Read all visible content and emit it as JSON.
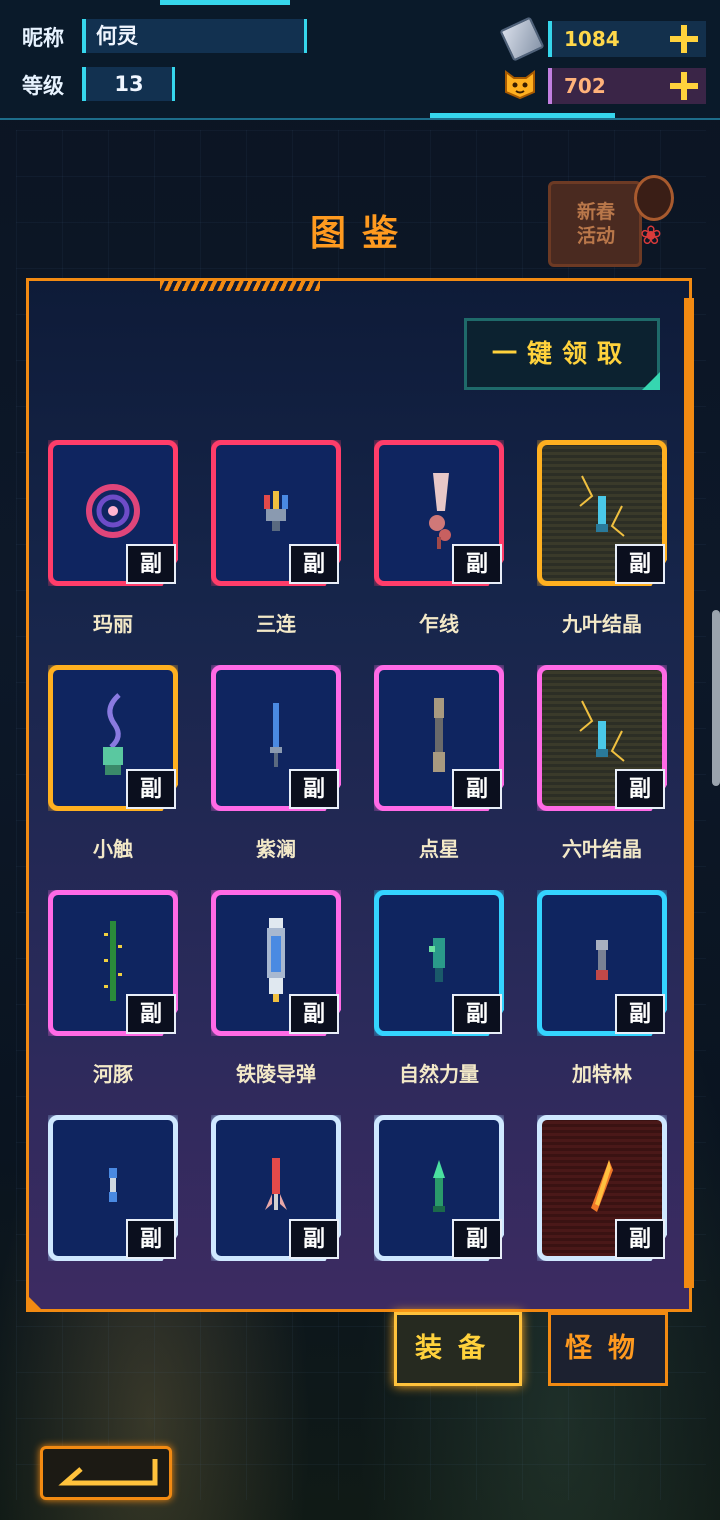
{
  "player": {
    "nickname_label": "昵称",
    "nickname": "何灵",
    "level_label": "等级",
    "level": "13"
  },
  "currency": {
    "ticket": {
      "icon": "ticket-icon",
      "amount": "1084"
    },
    "cat_coin": {
      "icon": "cat-coin-icon",
      "amount": "702"
    }
  },
  "header": {
    "title": "图鉴",
    "event_label": "新春\n活动"
  },
  "panel": {
    "claim_all_label": "一键领取",
    "badge_label": "副",
    "items": [
      {
        "name": "玛丽",
        "rarity": "red",
        "icon": "vortex-icon"
      },
      {
        "name": "三连",
        "rarity": "red",
        "icon": "triple-cannon-icon"
      },
      {
        "name": "乍线",
        "rarity": "red",
        "icon": "claw-weapon-icon"
      },
      {
        "name": "九叶结晶",
        "rarity": "gold",
        "icon": "crystal-blade-icon"
      },
      {
        "name": "小触",
        "rarity": "gold",
        "icon": "tentacle-icon"
      },
      {
        "name": "紫澜",
        "rarity": "pink",
        "icon": "blade-icon"
      },
      {
        "name": "点星",
        "rarity": "pink",
        "icon": "staff-icon"
      },
      {
        "name": "六叶结晶",
        "rarity": "pink",
        "icon": "crystal-blade-icon"
      },
      {
        "name": "河豚",
        "rarity": "pink",
        "icon": "spike-rod-icon"
      },
      {
        "name": "铁陵导弹",
        "rarity": "pink",
        "icon": "missile-icon"
      },
      {
        "name": "自然力量",
        "rarity": "cyan",
        "icon": "nature-gun-icon"
      },
      {
        "name": "加特林",
        "rarity": "cyan",
        "icon": "gatling-icon"
      },
      {
        "name": "",
        "rarity": "white",
        "icon": "small-cannon-icon"
      },
      {
        "name": "",
        "rarity": "white",
        "icon": "rocket-icon"
      },
      {
        "name": "",
        "rarity": "white",
        "icon": "green-dart-icon"
      },
      {
        "name": "",
        "rarity": "white",
        "icon": "flame-icon"
      }
    ]
  },
  "tabs": {
    "equipment": "装备",
    "monsters": "怪物"
  },
  "colors": {
    "accent_orange": "#f28a12",
    "accent_cyan": "#36d6ec",
    "title_orange": "#ff9a1f",
    "gold_text": "#ffd23c"
  }
}
